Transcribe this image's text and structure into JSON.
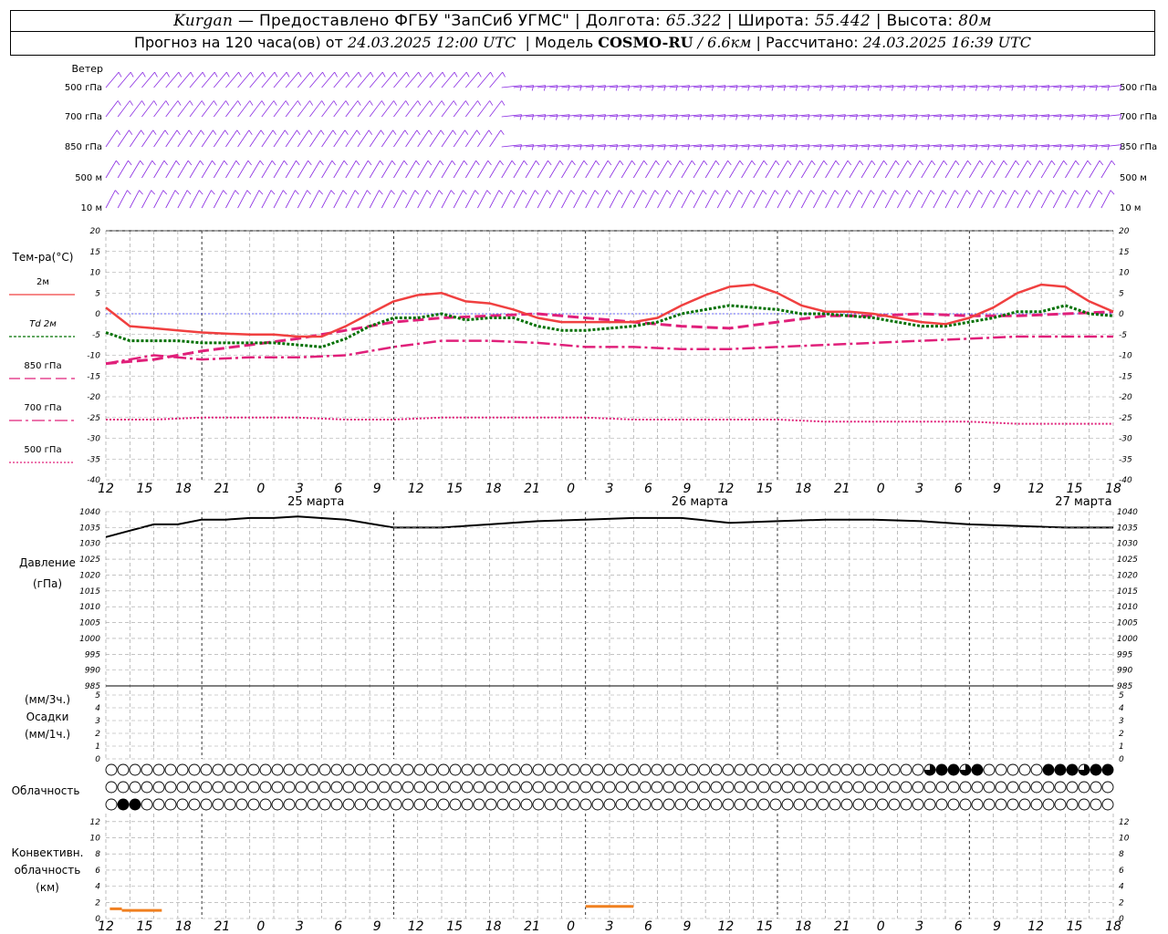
{
  "header": {
    "station": "Kurgan",
    "provider": "— Предоставлено ФГБУ \"ЗапСиб УГМС\" |",
    "lon_label": "Долгота:",
    "lon_value": "65.322",
    "lat_label": "| Широта:",
    "lat_value": "55.442",
    "alt_label": "| Высота:",
    "alt_value": "80м",
    "forecast_label": "Прогноз на 120 часа(ов) от",
    "forecast_start": "24.03.2025 12:00 UTC",
    "model_label": "| Модель",
    "model_name": "COSMO-RU",
    "model_res": "/ 6.6км",
    "calc_label": "| Рассчитано:",
    "calc_time": "24.03.2025 16:39 UTC"
  },
  "colors": {
    "wind": "#8a2be2",
    "t2m": "#f04040",
    "td2m": "#007000",
    "t850": "#e0207a",
    "t700": "#e0207a",
    "t500": "#e0207a",
    "pressure": "#000000",
    "convective": "#f08020",
    "grid": "#a0a0a0"
  },
  "panels": {
    "wind": {
      "title": "Ветер",
      "levels": [
        "500 гПа",
        "700 гПа",
        "850 гПа",
        "500 м",
        "10 м"
      ]
    },
    "temp": {
      "title": "Тем-ра(°C)",
      "legend": [
        {
          "label": "2м",
          "style": "solid"
        },
        {
          "label": "Td 2м",
          "style": "dotted"
        },
        {
          "label": "850 гПа",
          "style": "dashed"
        },
        {
          "label": "700 гПа",
          "style": "dashdot"
        },
        {
          "label": "500 гПа",
          "style": "dotted-fine"
        }
      ],
      "ticks": [
        "20",
        "15",
        "10",
        "5",
        "0",
        "-5",
        "-10",
        "-15",
        "-20",
        "-25",
        "-30",
        "-35",
        "-40"
      ]
    },
    "pressure": {
      "title": "Давление",
      "unit": "(гПа)",
      "ticks": [
        "1040",
        "1035",
        "1030",
        "1025",
        "1020",
        "1015",
        "1010",
        "1005",
        "1000",
        "995",
        "990",
        "985"
      ]
    },
    "precip": {
      "unit3h": "(мм/3ч.)",
      "title": "Осадки",
      "unit1h": "(мм/1ч.)",
      "ticks": [
        "5",
        "4",
        "3",
        "2",
        "1",
        "0"
      ]
    },
    "cloud": {
      "title": "Облачность"
    },
    "conv": {
      "title1": "Конвективн.",
      "title2": "облачность",
      "unit": "(км)",
      "ticks": [
        "12",
        "10",
        "8",
        "6",
        "4",
        "2",
        "0"
      ]
    }
  },
  "x_axis": {
    "hours": [
      "12",
      "15",
      "18",
      "21",
      "0",
      "3",
      "6",
      "9",
      "12",
      "15",
      "18",
      "21",
      "0",
      "3",
      "6",
      "9",
      "12",
      "15",
      "18",
      "21",
      "0",
      "3",
      "6",
      "9",
      "12",
      "15",
      "18"
    ],
    "dates": [
      {
        "label": "25 марта",
        "at": 4
      },
      {
        "label": "26 марта",
        "at": 12
      },
      {
        "label": "27 марта",
        "at": 20
      }
    ]
  },
  "chart_data": {
    "type": "line",
    "x_unit": "hours since 24.03.2025 12:00 UTC",
    "series": [
      {
        "name": "2м",
        "key": "t2m",
        "x": [
          0,
          3,
          6,
          9,
          12,
          15,
          18,
          21,
          24,
          27,
          30,
          33,
          36,
          39,
          42,
          45,
          48,
          51,
          54,
          57,
          60,
          63,
          66,
          69,
          72,
          75,
          78,
          81,
          84,
          87,
          90,
          93,
          96,
          99,
          102,
          105,
          108,
          111,
          114,
          117,
          120,
          123,
          126
        ],
        "y": [
          1.5,
          -3,
          -3.5,
          -4,
          -4.5,
          -4.8,
          -5,
          -5,
          -5.5,
          -5.5,
          -3,
          0,
          3,
          4.5,
          5,
          3,
          2.5,
          1,
          -1,
          -2,
          -2,
          -2,
          -2,
          -1,
          2,
          4.5,
          6.5,
          7,
          5,
          2,
          0.5,
          0.5,
          0,
          -1,
          -2,
          -2.5,
          -1,
          1.5,
          5,
          7,
          6.5,
          3,
          0.5
        ]
      },
      {
        "name": "Td 2м",
        "key": "td2m",
        "x": [
          0,
          3,
          6,
          9,
          12,
          15,
          18,
          21,
          24,
          27,
          30,
          33,
          36,
          39,
          42,
          45,
          48,
          51,
          54,
          57,
          60,
          63,
          66,
          69,
          72,
          75,
          78,
          81,
          84,
          87,
          90,
          93,
          96,
          99,
          102,
          105,
          108,
          111,
          114,
          117,
          120,
          123,
          126
        ],
        "y": [
          -4.5,
          -6.5,
          -6.5,
          -6.5,
          -7,
          -7,
          -7,
          -7,
          -7.5,
          -8,
          -6,
          -3,
          -1,
          -1,
          0,
          -1.5,
          -1,
          -1,
          -3,
          -4,
          -4,
          -3.5,
          -3,
          -2,
          0,
          1,
          2,
          1.5,
          1,
          0,
          0,
          -0.5,
          -1,
          -2,
          -3,
          -3,
          -2,
          -1,
          0.5,
          0.5,
          2,
          0,
          -0.5
        ]
      },
      {
        "name": "850 гПа",
        "key": "t850",
        "x": [
          0,
          6,
          12,
          18,
          24,
          30,
          36,
          42,
          48,
          54,
          60,
          66,
          72,
          78,
          84,
          90,
          96,
          102,
          108,
          114,
          120,
          126
        ],
        "y": [
          -12,
          -11,
          -9,
          -7.5,
          -6,
          -4,
          -2,
          -1,
          -0.5,
          0,
          -1,
          -2,
          -3,
          -3.5,
          -2,
          -0.5,
          -0.5,
          0,
          -0.5,
          -0.5,
          0,
          0.5
        ]
      },
      {
        "name": "700 гПа",
        "key": "t700",
        "x": [
          0,
          6,
          12,
          18,
          24,
          30,
          36,
          42,
          48,
          54,
          60,
          66,
          72,
          78,
          84,
          90,
          96,
          102,
          108,
          114,
          120,
          126
        ],
        "y": [
          -12,
          -10,
          -11,
          -10.5,
          -10.5,
          -10,
          -8,
          -6.5,
          -6.5,
          -7,
          -8,
          -8,
          -8.5,
          -8.5,
          -8,
          -7.5,
          -7,
          -6.5,
          -6,
          -5.5,
          -5.5,
          -5.5
        ]
      },
      {
        "name": "500 гПа",
        "key": "t500",
        "x": [
          0,
          6,
          12,
          18,
          24,
          30,
          36,
          42,
          48,
          54,
          60,
          66,
          72,
          78,
          84,
          90,
          96,
          102,
          108,
          114,
          120,
          126
        ],
        "y": [
          -25.5,
          -25.5,
          -25,
          -25,
          -25,
          -25.5,
          -25.5,
          -25,
          -25,
          -25,
          -25,
          -25.5,
          -25.5,
          -25.5,
          -25.5,
          -26,
          -26,
          -26,
          -26,
          -26.5,
          -26.5,
          -26.5
        ]
      },
      {
        "name": "Давление",
        "key": "pressure",
        "x": [
          0,
          3,
          6,
          9,
          12,
          15,
          18,
          21,
          24,
          30,
          36,
          42,
          48,
          54,
          60,
          66,
          72,
          78,
          84,
          90,
          96,
          102,
          108,
          114,
          120,
          126
        ],
        "y": [
          1032,
          1034,
          1036,
          1036,
          1037.5,
          1037.5,
          1038,
          1038,
          1038.5,
          1037.5,
          1035,
          1035,
          1036,
          1037,
          1037.5,
          1038,
          1038,
          1036.5,
          1037,
          1037.5,
          1037.5,
          1037,
          1036,
          1035.5,
          1035,
          1035
        ]
      },
      {
        "name": "Конвективн. облачность",
        "key": "conv",
        "segments": [
          {
            "x": [
              0.5,
              2
            ],
            "y": [
              1.2,
              1.2
            ]
          },
          {
            "x": [
              2,
              7
            ],
            "y": [
              1.0,
              1.0
            ]
          },
          {
            "x": [
              60,
              66
            ],
            "y": [
              1.5,
              1.5
            ]
          }
        ]
      }
    ],
    "ylim_temp": [
      -40,
      20
    ],
    "ylim_pressure": [
      985,
      1040
    ],
    "ylim_precip": [
      0,
      5
    ],
    "ylim_conv": [
      0,
      13
    ],
    "cloud_rows": {
      "upper": "0000000000000000000000000000000000000000000000000000000000000000000003443400000444344000033000000000000000000000000000033444444",
      "middle": "000000000000000000000000000000000000000000000000000000000000000000000000000000000000000000000000000000000000000000000000000000",
      "low": "0440000000000000000000000000000000000000000000000000000000000000000000000000000000000000000000000000000000000000000000000000000"
    }
  }
}
